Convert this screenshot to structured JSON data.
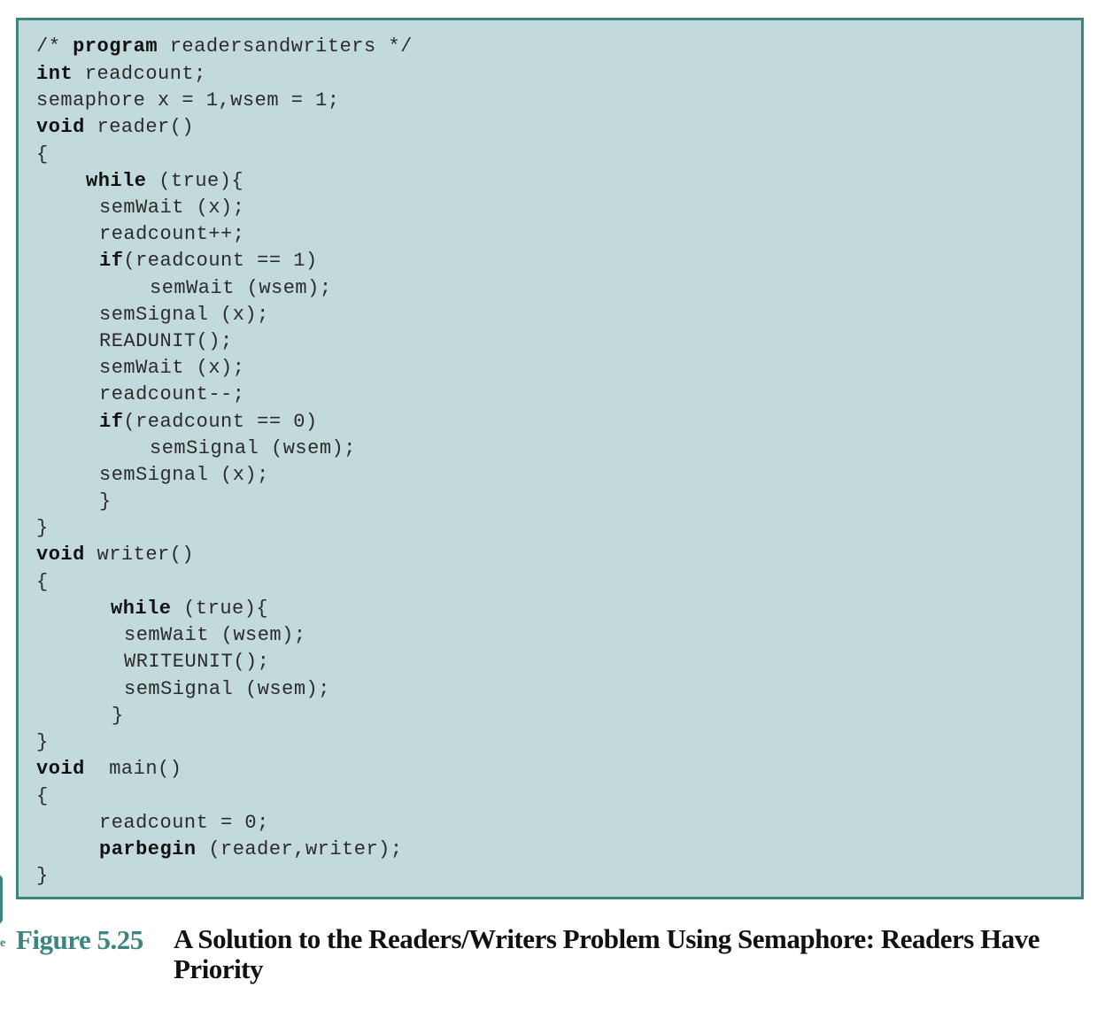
{
  "code": {
    "l01": {
      "a": "/* ",
      "kw": "program",
      "b": " readersandwriters */"
    },
    "l02": {
      "kw": "int",
      "b": " readcount;"
    },
    "l03": {
      "a": "semaphore x = 1,wsem = 1;"
    },
    "l04": {
      "kw": "void",
      "b": " reader()"
    },
    "l05": {
      "a": "{"
    },
    "l06": {
      "kw": "while",
      "b": " (true){"
    },
    "l07": {
      "a": "semWait (x);"
    },
    "l08": {
      "a": "readcount++;"
    },
    "l09": {
      "kw": "if",
      "b": "(readcount == 1)"
    },
    "l10": {
      "a": "semWait (wsem);"
    },
    "l11": {
      "a": "semSignal (x);"
    },
    "l12": {
      "a": "READUNIT();"
    },
    "l13": {
      "a": "semWait (x);"
    },
    "l14": {
      "a": "readcount--;"
    },
    "l15": {
      "kw": "if",
      "b": "(readcount == 0)"
    },
    "l16": {
      "a": "semSignal (wsem);"
    },
    "l17": {
      "a": "semSignal (x);"
    },
    "l18": {
      "a": "}"
    },
    "l19": {
      "a": "}"
    },
    "l20": {
      "kw": "void",
      "b": " writer()"
    },
    "l21": {
      "a": "{"
    },
    "l22": {
      "kw": "while",
      "b": " (true){"
    },
    "l23": {
      "a": "semWait (wsem);"
    },
    "l24": {
      "a": "WRITEUNIT();"
    },
    "l25": {
      "a": "semSignal (wsem);"
    },
    "l26": {
      "a": "}"
    },
    "l27": {
      "a": "}"
    },
    "l28": {
      "kw": "void",
      "b": "  main()"
    },
    "l29": {
      "a": "{"
    },
    "l30": {
      "a": "readcount = 0;"
    },
    "l31": {
      "kw": "parbegin",
      "b": " (reader,writer);"
    },
    "l32": {
      "a": "}"
    }
  },
  "caption": {
    "bullet": "e",
    "label": "Figure 5.25",
    "title": "A Solution to the Readers/Writers Problem Using Semaphore: Readers Have Priority"
  },
  "colors": {
    "box_background": "#c3dadc",
    "box_border": "#3e8580",
    "figure_label": "#3e8580"
  }
}
